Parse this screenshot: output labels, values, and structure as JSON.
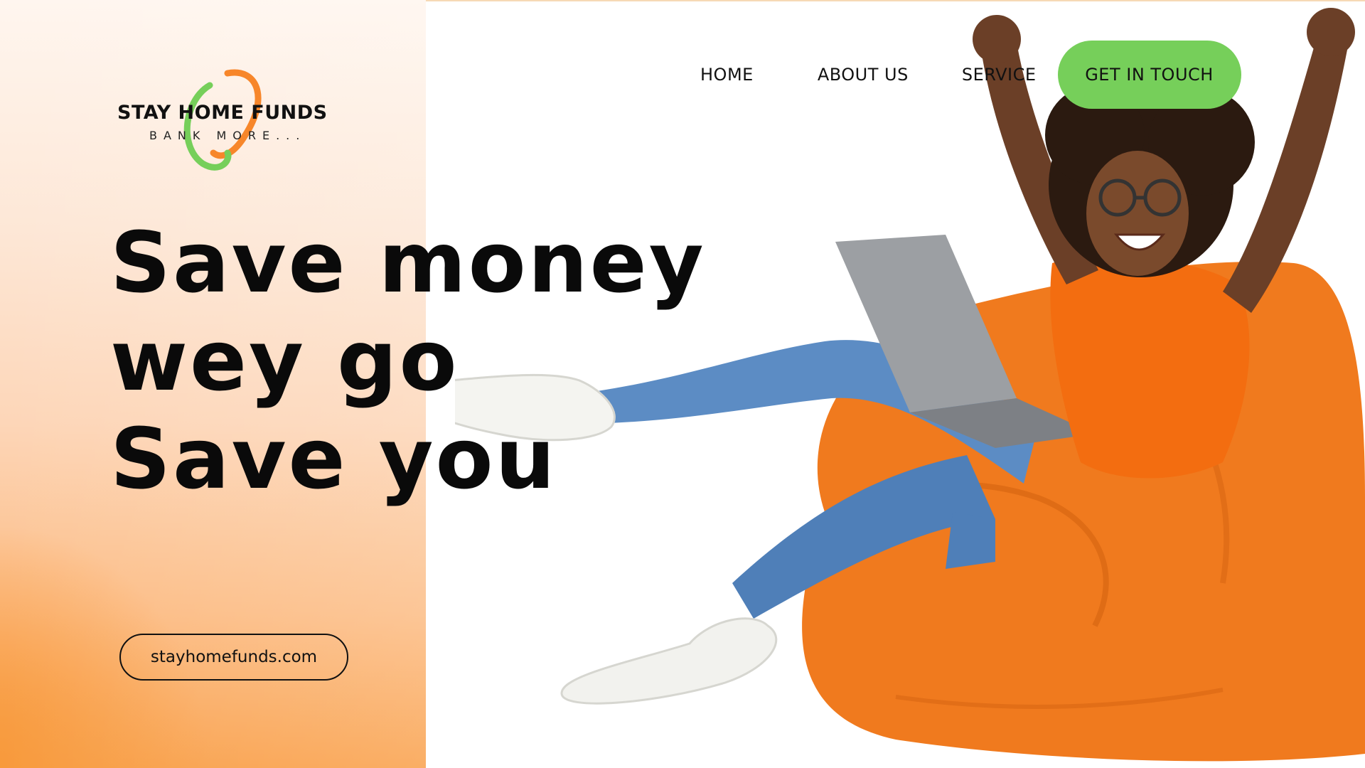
{
  "brand": {
    "name": "STAY HOME FUNDS",
    "tagline": "BANK MORE...",
    "colors": {
      "green": "#76cf5a",
      "orange": "#f7862a",
      "text": "#111111"
    }
  },
  "nav": {
    "items": [
      {
        "label": "HOME"
      },
      {
        "label": "ABOUT US"
      },
      {
        "label": "SERVICE"
      }
    ],
    "cta": {
      "label": "GET IN TOUCH"
    }
  },
  "hero": {
    "headline": "Save money wey go Save you",
    "image": "woman-celebrating-on-orange-beanbag-with-laptop"
  },
  "footer_link": {
    "url_label": "stayhomefunds.com"
  }
}
